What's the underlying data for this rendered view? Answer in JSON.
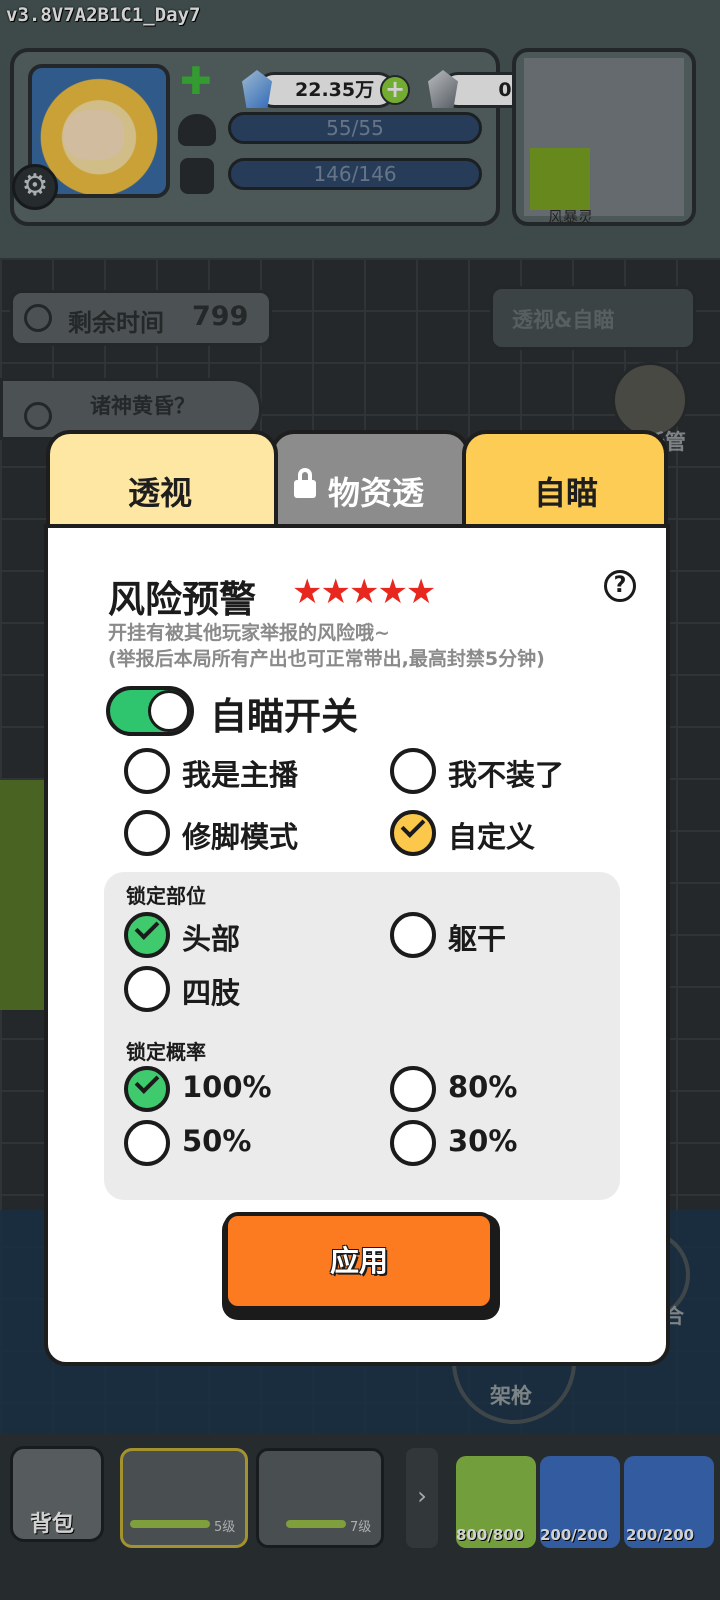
{
  "version": "v3.8V7A2B1C1_Day7",
  "hud": {
    "blue_gems": "22.35万",
    "grey_gems": "0",
    "helmet_durability": "55/55",
    "armor_durability": "146/146",
    "minimap_label": "风暴灵"
  },
  "game": {
    "timer_label": "剩余时间",
    "timer_value": "799",
    "xray_aim_button": "透视&自瞄",
    "event_label": "诸神黄昏？",
    "auto_label": "托管",
    "mount_gun_label": "架枪",
    "right_action_label": "合",
    "backpack_label": "背包",
    "weapon_slot_1_level": "5级",
    "weapon_slot_2_level": "7级",
    "bag_1_capacity": "800/800",
    "bag_2_capacity": "200/200",
    "bag_3_capacity": "200/200"
  },
  "modal": {
    "tabs": [
      {
        "label": "透视"
      },
      {
        "label": "物资透"
      },
      {
        "label": "自瞄"
      }
    ],
    "risk_title": "风险预警",
    "stars": "★★★★★",
    "help": "?",
    "warning_line_1": "开挂有被其他玩家举报的风险哦~",
    "warning_line_2": "(举报后本局所有产出也可正常带出,最高封禁5分钟)",
    "toggle_label": "自瞄开关",
    "modes": [
      {
        "label": "我是主播"
      },
      {
        "label": "我不装了"
      },
      {
        "label": "修脚模式"
      },
      {
        "label": "自定义"
      }
    ],
    "lock_part_title": "锁定部位",
    "parts": [
      {
        "label": "头部"
      },
      {
        "label": "躯干"
      },
      {
        "label": "四肢"
      }
    ],
    "lock_prob_title": "锁定概率",
    "probs": [
      {
        "label": "100%"
      },
      {
        "label": "80%"
      },
      {
        "label": "50%"
      },
      {
        "label": "30%"
      }
    ],
    "apply_label": "应用"
  },
  "colors": {
    "tab_xray": "#fde7a2",
    "tab_supply": "#8c8c8c",
    "tab_aim": "#fccc55",
    "toggle_on": "#2fc46e",
    "radio_selected_mode": "#fcc84c",
    "radio_selected_lock": "#3fca6e",
    "stars": "#e8271f",
    "apply_button": "#fc7a20"
  }
}
